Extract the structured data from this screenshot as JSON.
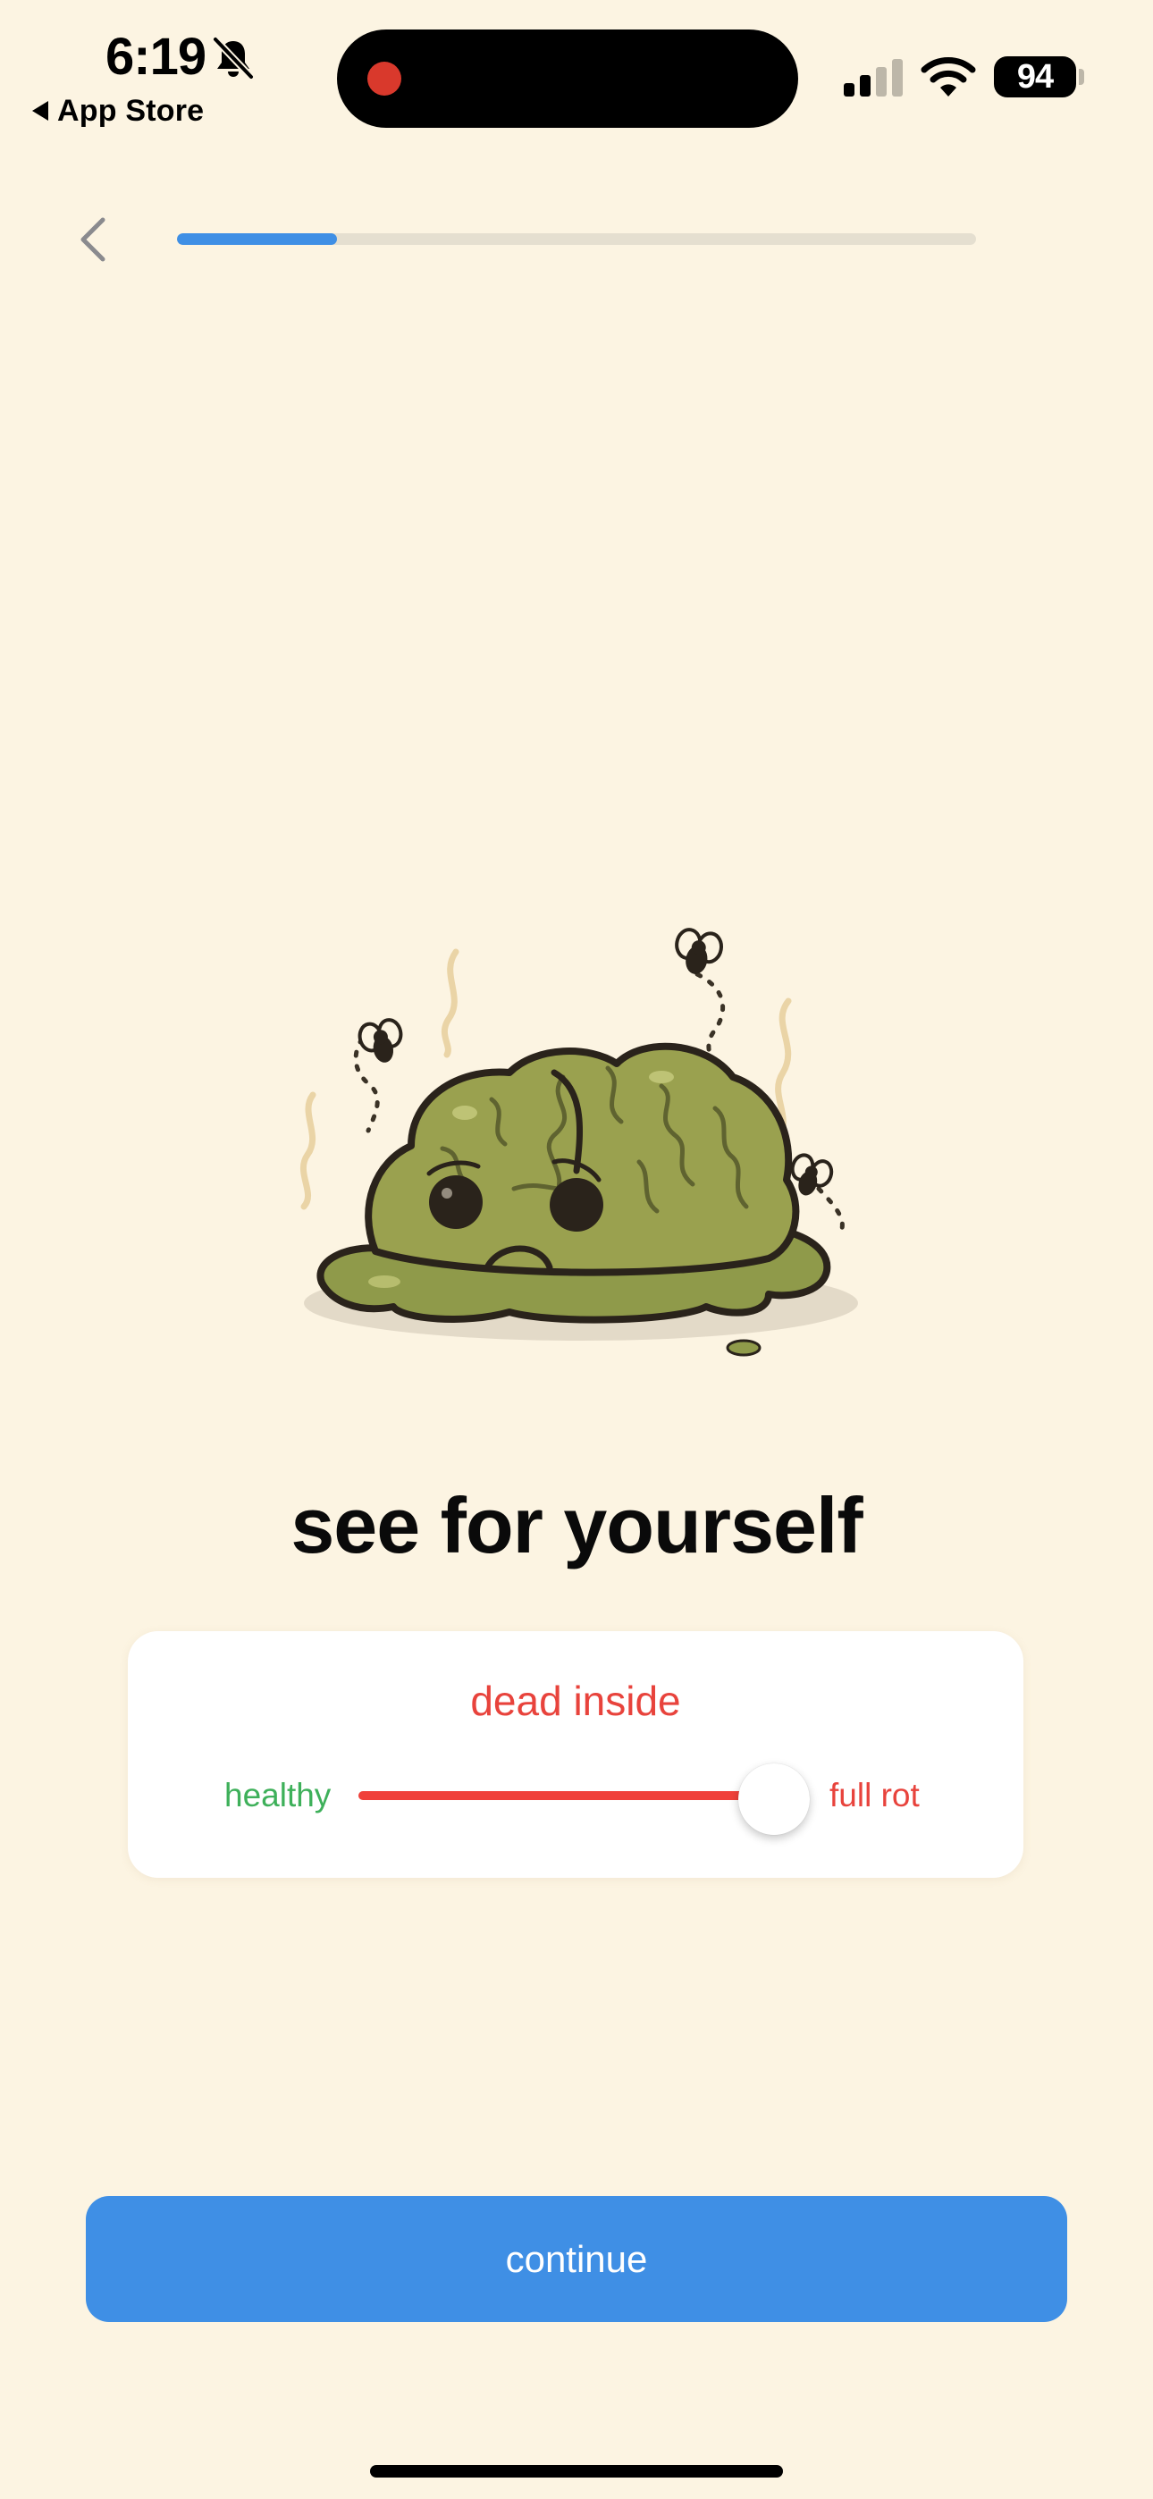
{
  "status_bar": {
    "time": "6:19",
    "back_app": "App Store",
    "battery": "94",
    "icons": [
      "bell-slash-icon",
      "signal-icon",
      "wifi-icon",
      "battery-icon"
    ]
  },
  "nav": {
    "back_icon": "chevron-left-icon",
    "progress": 0.2
  },
  "illustration": {
    "name": "rotting-brain-illustration"
  },
  "title": "see for yourself",
  "slider_card": {
    "status": "dead inside",
    "left_label": "healthy",
    "right_label": "full rot",
    "value": 0.92
  },
  "continue_label": "continue",
  "colors": {
    "background": "#FCF4E2",
    "accent": "#3F8FE5",
    "danger": "#E8433C",
    "healthy": "#3EB05A",
    "brain": "#8F9A4A"
  }
}
